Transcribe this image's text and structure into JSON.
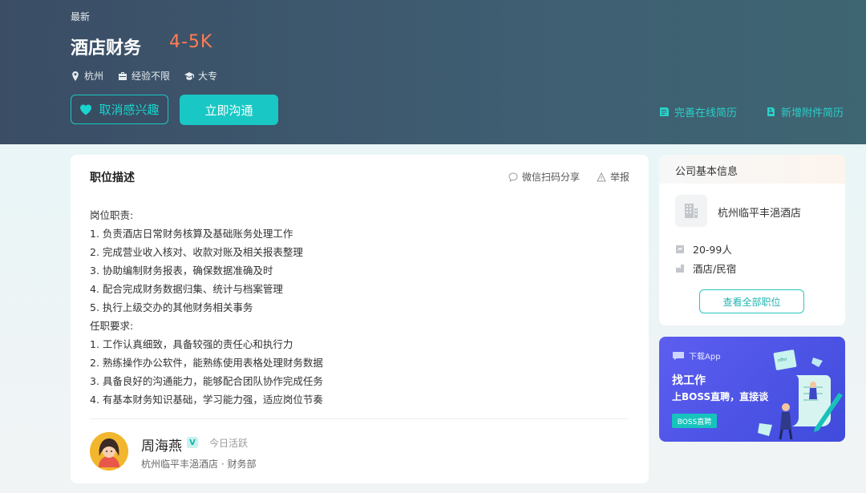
{
  "header": {
    "new_badge": "最新",
    "title": "酒店财务",
    "salary": "4-5K",
    "meta": {
      "city": "杭州",
      "experience": "经验不限",
      "education": "大专"
    },
    "unlike_label": "取消感兴趣",
    "chat_label": "立即沟通",
    "link_resume": "完善在线简历",
    "link_attach": "新增附件简历"
  },
  "job": {
    "section_title": "职位描述",
    "share": "微信扫码分享",
    "report": "举报",
    "lines": [
      "岗位职责:",
      "1. 负责酒店日常财务核算及基础账务处理工作",
      "2. 完成营业收入核对、收款对账及相关报表整理",
      "3. 协助编制财务报表，确保数据准确及时",
      "4. 配合完成财务数据归集、统计与档案管理",
      "5. 执行上级交办的其他财务相关事务",
      "任职要求:",
      "1. 工作认真细致，具备较强的责任心和执行力",
      "2. 熟练操作办公软件，能熟练使用表格处理财务数据",
      "3. 具备良好的沟通能力，能够配合团队协作完成任务",
      "4. 有基本财务知识基础，学习能力强，适应岗位节奏"
    ]
  },
  "recruiter": {
    "name": "周海燕",
    "verified": "V",
    "active": "今日活跃",
    "company": "杭州临平丰浥酒店 · 财务部"
  },
  "company": {
    "section_title": "公司基本信息",
    "name": "杭州临平丰浥酒店",
    "size": "20-99人",
    "industry": "酒店/民宿",
    "view_all": "查看全部职位"
  },
  "app_banner": {
    "download": "下载App",
    "line1": "找工作",
    "line2": "上BOSS直聘，直接谈",
    "tag": "BOSS直聘",
    "illu_note": "offer"
  },
  "colors": {
    "accent": "#19c8c4",
    "salary": "#ff7d53",
    "hero_bg": "#3a4d65",
    "banner_bg": "#4f55e8"
  }
}
